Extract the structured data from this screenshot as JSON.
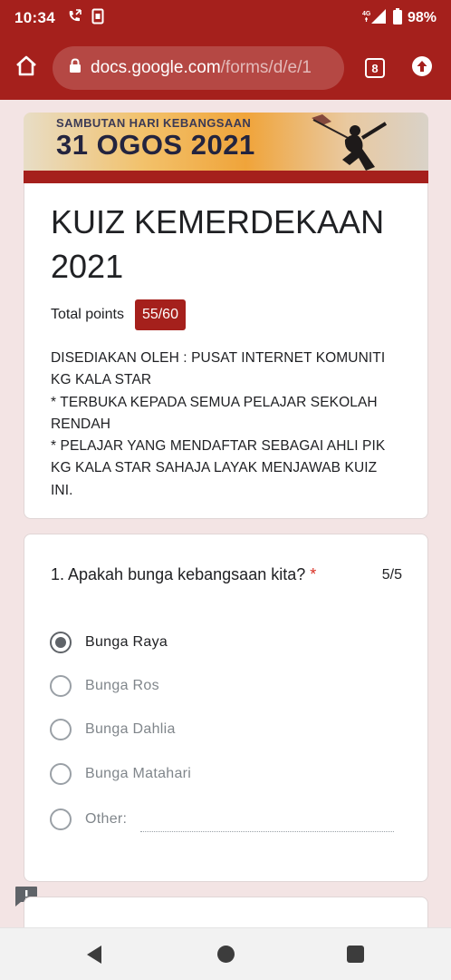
{
  "status_bar": {
    "time": "10:34",
    "battery": "98%",
    "icons": [
      "call-forward-icon",
      "sim-icon",
      "signal-4g-icon",
      "battery-icon"
    ]
  },
  "browser": {
    "url_domain": "docs.google.com",
    "url_path": "/forms/d/e/1",
    "tab_count": "8",
    "icons": [
      "home-icon",
      "lock-icon",
      "tabs-icon",
      "upload-icon"
    ]
  },
  "banner": {
    "subtitle": "SAMBUTAN HARI KEBANGSAAN",
    "title": "31 OGOS 2021"
  },
  "form": {
    "title": "KUIZ KEMERDEKAAN 2021",
    "points_label": "Total points",
    "points_value": "55/60",
    "description": "DISEDIAKAN OLEH : PUSAT INTERNET KOMUNITI\nKG KALA STAR\n* TERBUKA KEPADA SEMUA PELAJAR SEKOLAH\nRENDAH\n* PELAJAR YANG MENDAFTAR SEBAGAI AHLI PIK\nKG KALA STAR SAHAJA LAYAK MENJAWAB KUIZ\nINI."
  },
  "question1": {
    "text": "1. Apakah bunga kebangsaan kita?",
    "required_mark": "*",
    "score": "5/5",
    "options": [
      {
        "label": "Bunga Raya",
        "selected": true
      },
      {
        "label": "Bunga Ros",
        "selected": false
      },
      {
        "label": "Bunga Dahlia",
        "selected": false
      },
      {
        "label": "Bunga Matahari",
        "selected": false
      },
      {
        "label": "Other:",
        "selected": false
      }
    ]
  },
  "colors": {
    "theme": "#a5201c",
    "background": "#f3e4e4"
  }
}
